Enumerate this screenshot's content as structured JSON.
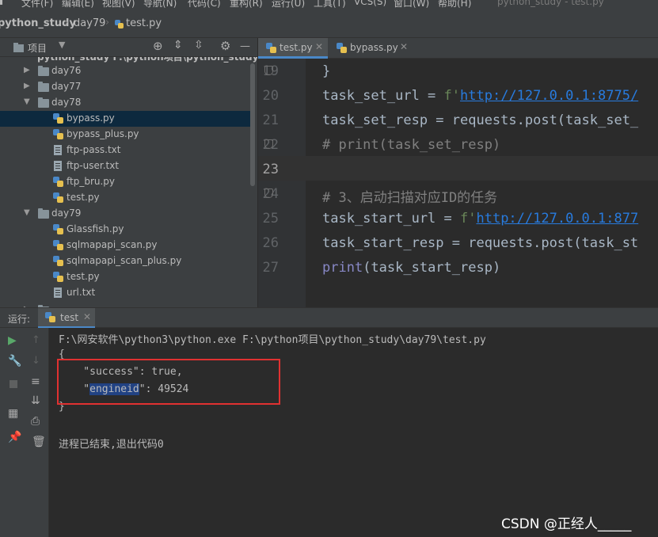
{
  "menu": {
    "items": [
      "文件(F)",
      "编辑(E)",
      "视图(V)",
      "导航(N)",
      "代码(C)",
      "重构(R)",
      "运行(U)",
      "工具(T)",
      "VCS(S)",
      "窗口(W)",
      "帮助(H)"
    ],
    "window_title": "python_study - test.py"
  },
  "breadcrumb": {
    "project": "python_study",
    "folder": "day79",
    "file": "test.py"
  },
  "project_panel": {
    "title": "项目",
    "root_partial": "python_study  F:\\python项目\\python_study",
    "tree": [
      {
        "label": "day76",
        "type": "folder",
        "expanded": false
      },
      {
        "label": "day77",
        "type": "folder",
        "expanded": false
      },
      {
        "label": "day78",
        "type": "folder",
        "expanded": true
      },
      {
        "label": "bypass.py",
        "type": "py",
        "selected": true
      },
      {
        "label": "bypass_plus.py",
        "type": "py"
      },
      {
        "label": "ftp-pass.txt",
        "type": "txt"
      },
      {
        "label": "ftp-user.txt",
        "type": "txt"
      },
      {
        "label": "ftp_bru.py",
        "type": "py"
      },
      {
        "label": "test.py",
        "type": "py"
      },
      {
        "label": "day79",
        "type": "folder",
        "expanded": true
      },
      {
        "label": "Glassfish.py",
        "type": "py"
      },
      {
        "label": "sqlmapapi_scan.py",
        "type": "py"
      },
      {
        "label": "sqlmapapi_scan_plus.py",
        "type": "py"
      },
      {
        "label": "test.py",
        "type": "py"
      },
      {
        "label": "url.txt",
        "type": "txt"
      }
    ]
  },
  "editor": {
    "tabs": [
      {
        "label": "test.py",
        "active": true
      },
      {
        "label": "bypass.py",
        "active": false
      }
    ],
    "line_numbers": [
      "19",
      "20",
      "21",
      "22",
      "23",
      "24",
      "25",
      "26",
      "27"
    ],
    "current_line": "23",
    "lines": {
      "l19": "}",
      "l20_var": "task_set_url = ",
      "l20_f": "f'",
      "l20_url": "http://127.0.0.1:8775/",
      "l21": "task_set_resp = requests.post(task_set_",
      "l22": "# print(task_set_resp)",
      "l23": "",
      "l24": "# 3、启动扫描对应ID的任务",
      "l25_var": "task_start_url = ",
      "l25_f": "f'",
      "l25_url": "http://127.0.0.1:877",
      "l26": "task_start_resp = requests.post(task_st",
      "l27_fn": "print",
      "l27_rest": "(task_start_resp)"
    }
  },
  "run_panel": {
    "label": "运行:",
    "tab": "test",
    "output": {
      "command": "F:\\网安软件\\python3\\python.exe F:\\python项目\\python_study\\day79\\test.py",
      "brace_open": "{",
      "line1": "    \"success\": true,",
      "line2_pre": "    \"",
      "line2_key": "engineid",
      "line2_post": "\": 49524",
      "brace_close": "}",
      "exit": "进程已结束,退出代码0"
    }
  },
  "watermark": "CSDN @正经人_____",
  "colors": {
    "accent": "#4a88c7",
    "highlight_box": "#e03131",
    "selection": "#0d293e",
    "string": "#6a8759",
    "url": "#287bde",
    "comment": "#808080"
  }
}
